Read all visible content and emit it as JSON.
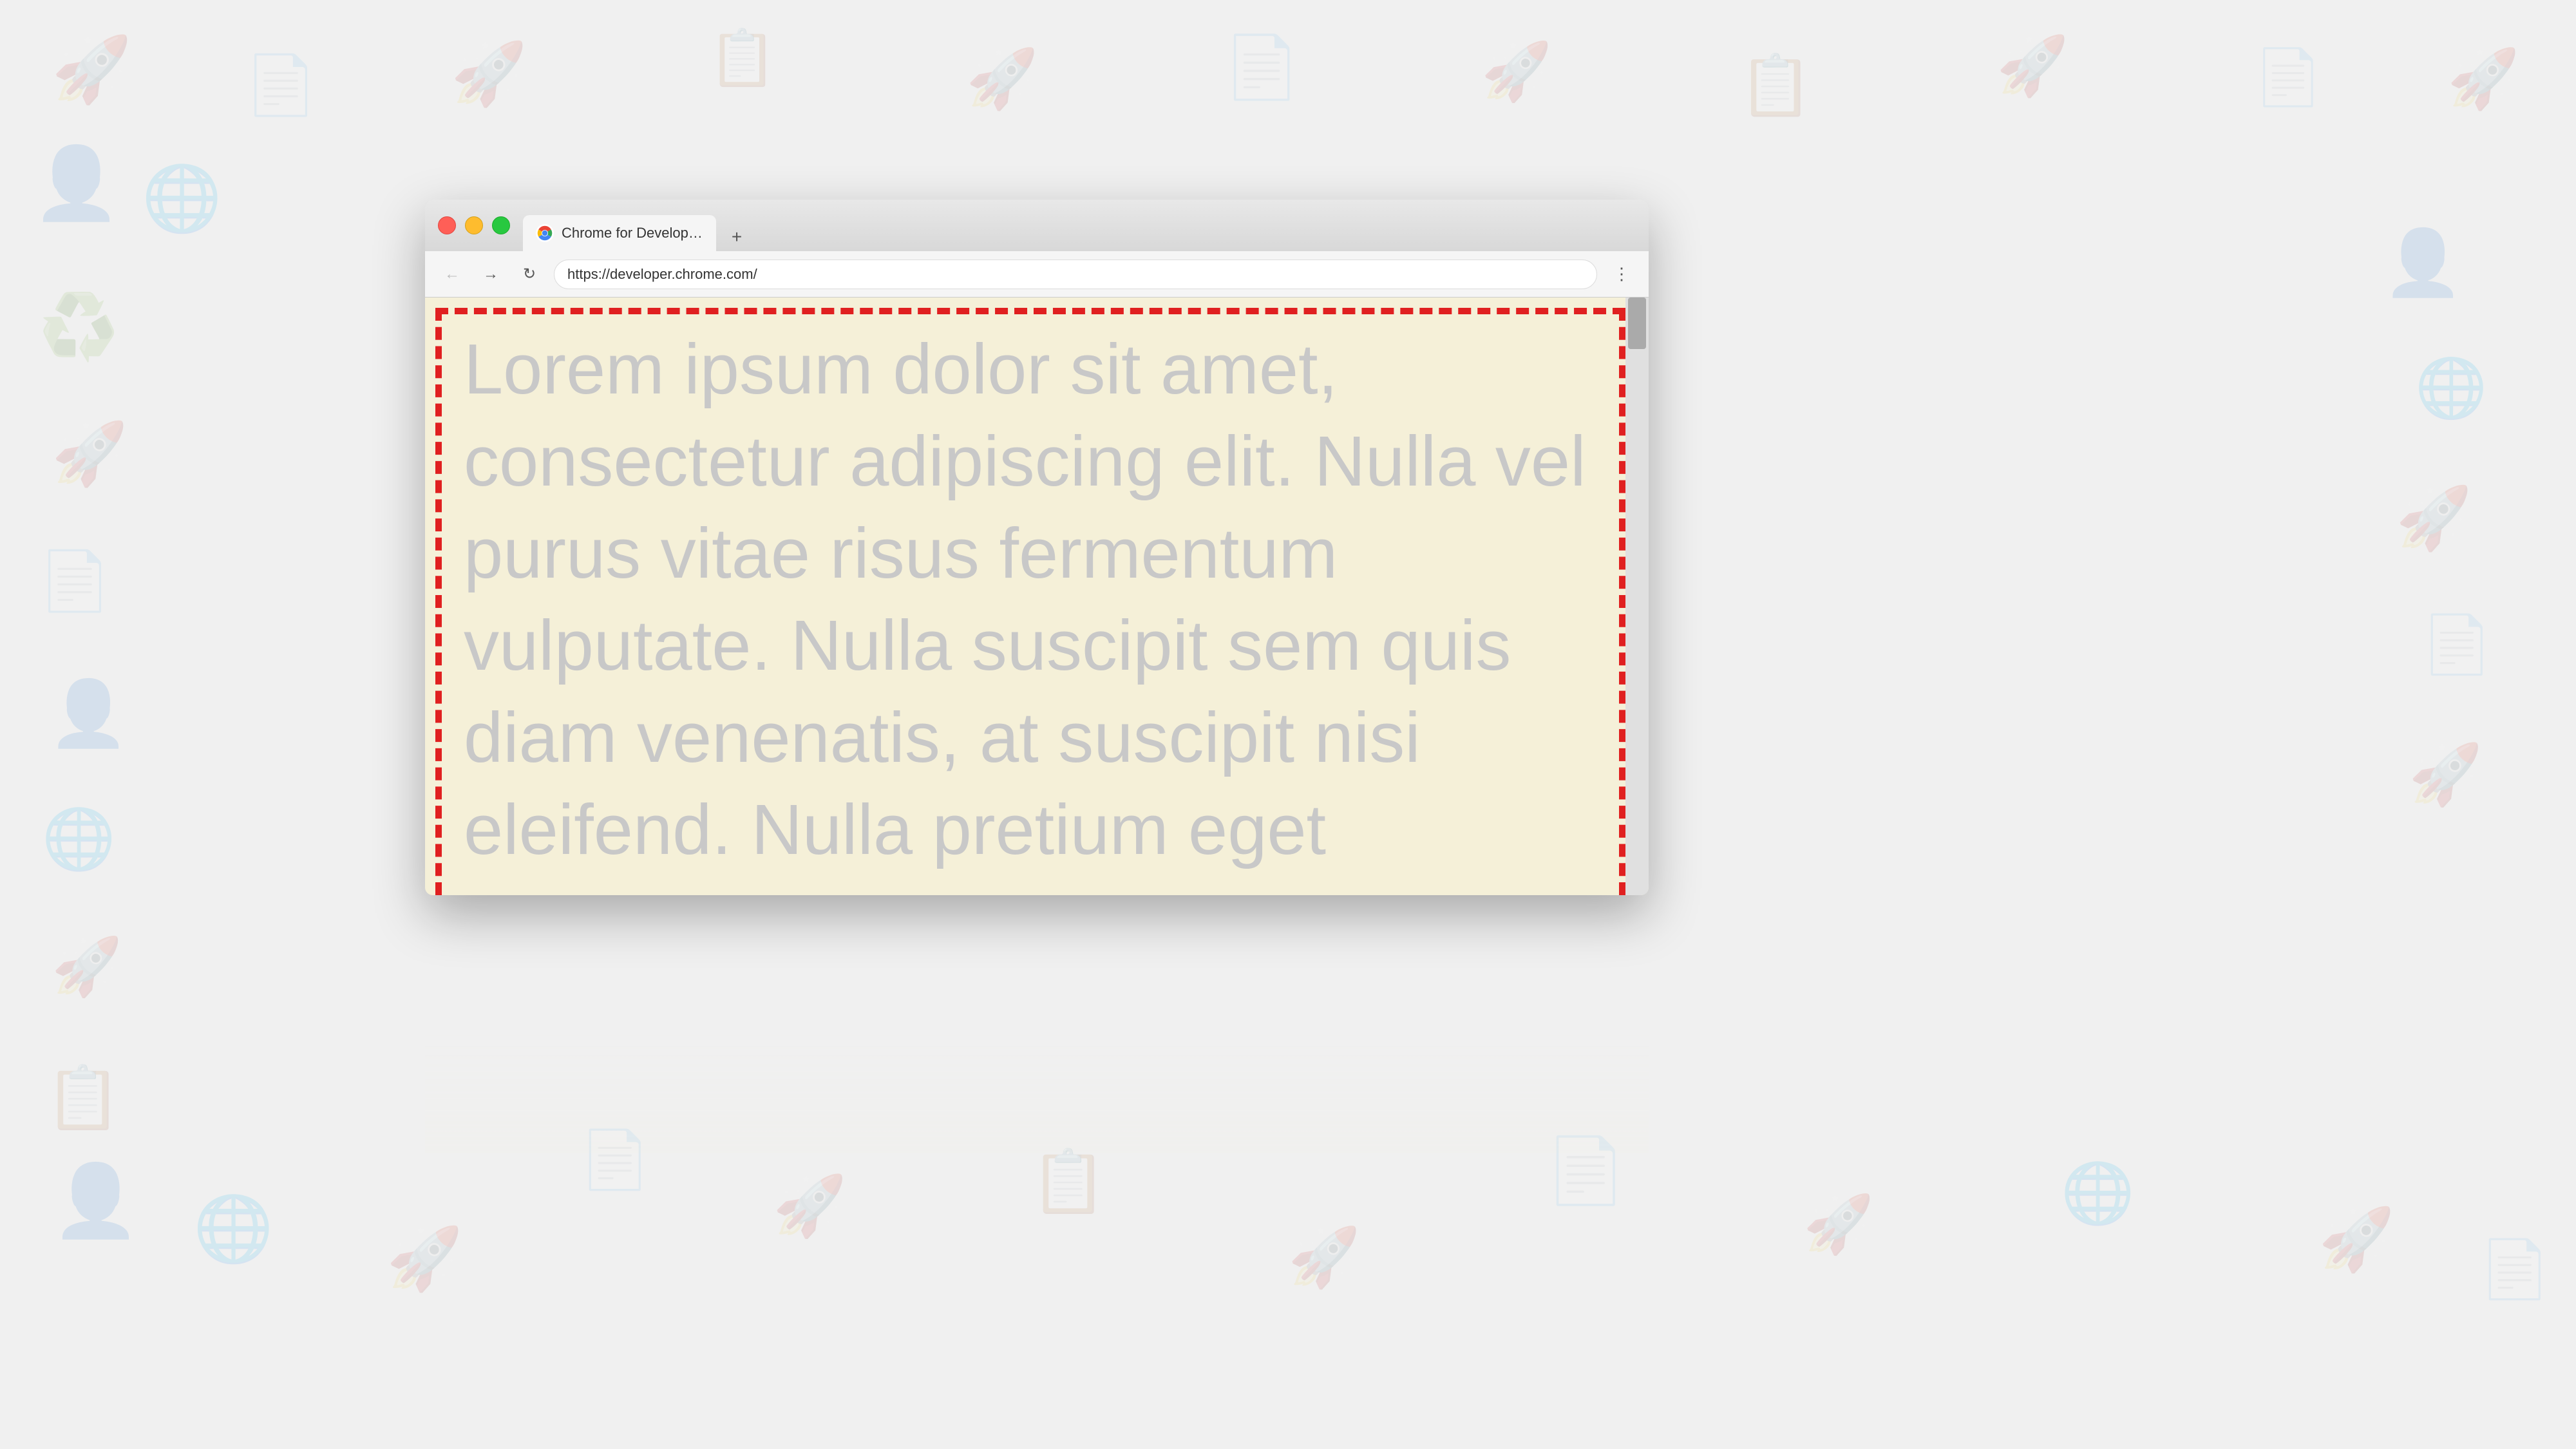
{
  "background": {
    "color": "#efefef"
  },
  "browser": {
    "tab": {
      "title": "Chrome for Developers",
      "favicon_alt": "Chrome logo",
      "new_tab_btn": "+"
    },
    "address_bar": {
      "url": "https://developer.chrome.com/"
    },
    "nav": {
      "back_label": "←",
      "forward_label": "→",
      "reload_label": "↻",
      "menu_label": "⋮"
    },
    "page": {
      "lorem_text": "Lorem ipsum dolor sit amet, consectetur adipiscing elit. Nulla vel purus vitae risus fermentum vulputate. Nulla suscipit sem quis diam venenatis, at suscipit nisi eleifend. Nulla pretium eget"
    }
  },
  "traffic_lights": {
    "red": "#ff5f57",
    "yellow": "#febc2e",
    "green": "#28c840"
  },
  "dashed_border": {
    "color": "#e02020"
  }
}
